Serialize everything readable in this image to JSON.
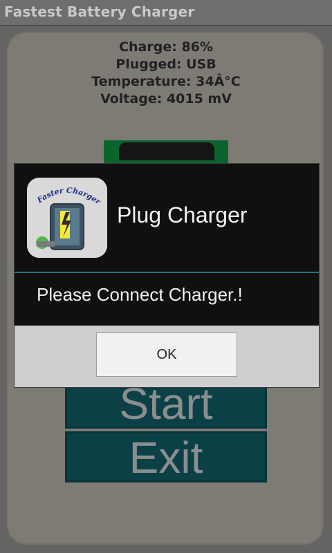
{
  "app": {
    "title": "Fastest Battery Charger"
  },
  "info": {
    "charge": "Charge: 86%",
    "plugged": "Plugged: USB",
    "temperature": "Temperature: 34Â°C",
    "voltage": "Voltage: 4015 mV"
  },
  "buttons": {
    "start": "Start",
    "exit": "Exit"
  },
  "dialog": {
    "icon_text": "Faster Charger",
    "title": "Plug Charger",
    "message": "Please Connect Charger.!",
    "ok_label": "OK"
  },
  "icons": {
    "app_icon": "faster-charger-app-icon"
  },
  "colors": {
    "accent": "#0f7a38",
    "button_bg": "#0e4f56",
    "dialog_divider": "#2e6f86"
  }
}
